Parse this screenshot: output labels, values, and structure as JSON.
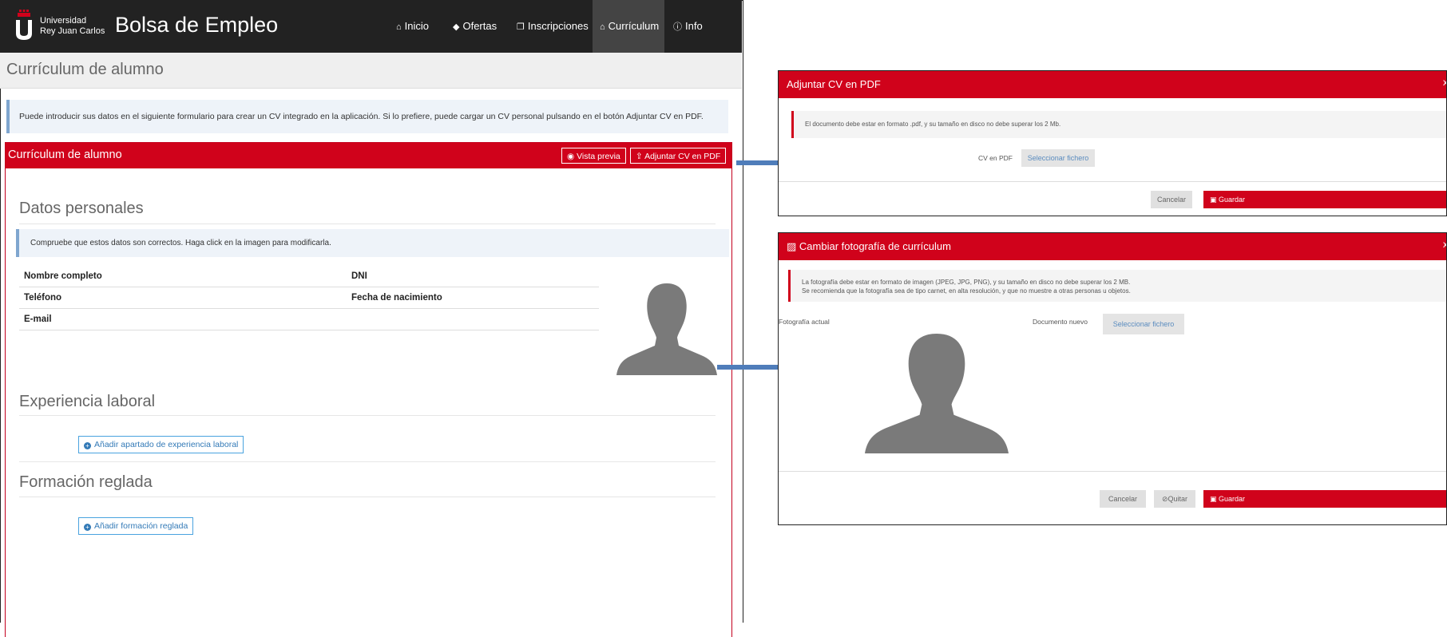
{
  "header": {
    "logo_line1": "Universidad",
    "logo_line2": "Rey Juan Carlos",
    "app_title": "Bolsa de Empleo",
    "nav": [
      {
        "label": "Inicio",
        "icon": "home-icon"
      },
      {
        "label": "Ofertas",
        "icon": "tag-icon"
      },
      {
        "label": "Inscripciones",
        "icon": "copy-icon"
      },
      {
        "label": "Currículum",
        "icon": "home-icon",
        "active": true
      },
      {
        "label": "Info",
        "icon": "info-icon"
      }
    ]
  },
  "page": {
    "title": "Currículum de alumno",
    "intro": "Puede introducir sus datos en el siguiente formulario para crear un CV integrado en la aplicación. Si lo prefiere, puede cargar un CV personal pulsando en el botón Adjuntar CV en PDF."
  },
  "panel": {
    "title": "Currículum de alumno",
    "preview_button": "Vista previa",
    "attach_button": "Adjuntar CV en PDF",
    "personal": {
      "heading": "Datos personales",
      "notice": "Compruebe que estos datos son correctos. Haga click en la imagen para modificarla.",
      "full_name_label": "Nombre completo",
      "dni_label": "DNI",
      "phone_label": "Teléfono",
      "birth_label": "Fecha de nacimiento",
      "email_label": "E-mail"
    },
    "experience": {
      "heading": "Experiencia laboral",
      "add_button": "Añadir apartado de experiencia laboral"
    },
    "education": {
      "heading": "Formación reglada",
      "add_button": "Añadir formación reglada"
    }
  },
  "dialog_pdf": {
    "title": "Adjuntar CV en PDF",
    "close": "x",
    "notice": "El documento debe estar en formato .pdf, y su tamaño en disco no debe superar los 2 Mb.",
    "field_label": "CV en PDF",
    "file_button": "Seleccionar fichero",
    "cancel": "Cancelar",
    "save": "Guardar"
  },
  "dialog_photo": {
    "title": "Cambiar fotografía de currículum",
    "close": "x",
    "notice_line1": "La fotografía debe estar en formato de imagen (JPEG, JPG, PNG), y su tamaño en disco no debe superar los 2 MB.",
    "notice_line2": "Se recomienda que la fotografía sea de tipo carnet, en alta resolución, y que no muestre a otras personas u objetos.",
    "current_label": "Fotografía actual",
    "new_label": "Documento nuevo",
    "file_button": "Seleccionar fichero",
    "cancel": "Cancelar",
    "remove": "Quitar",
    "save": "Guardar"
  },
  "colors": {
    "brand_red": "#d0021b",
    "navbar": "#222222",
    "arrow": "#4f7dba",
    "info_border": "#7fa6cf"
  }
}
